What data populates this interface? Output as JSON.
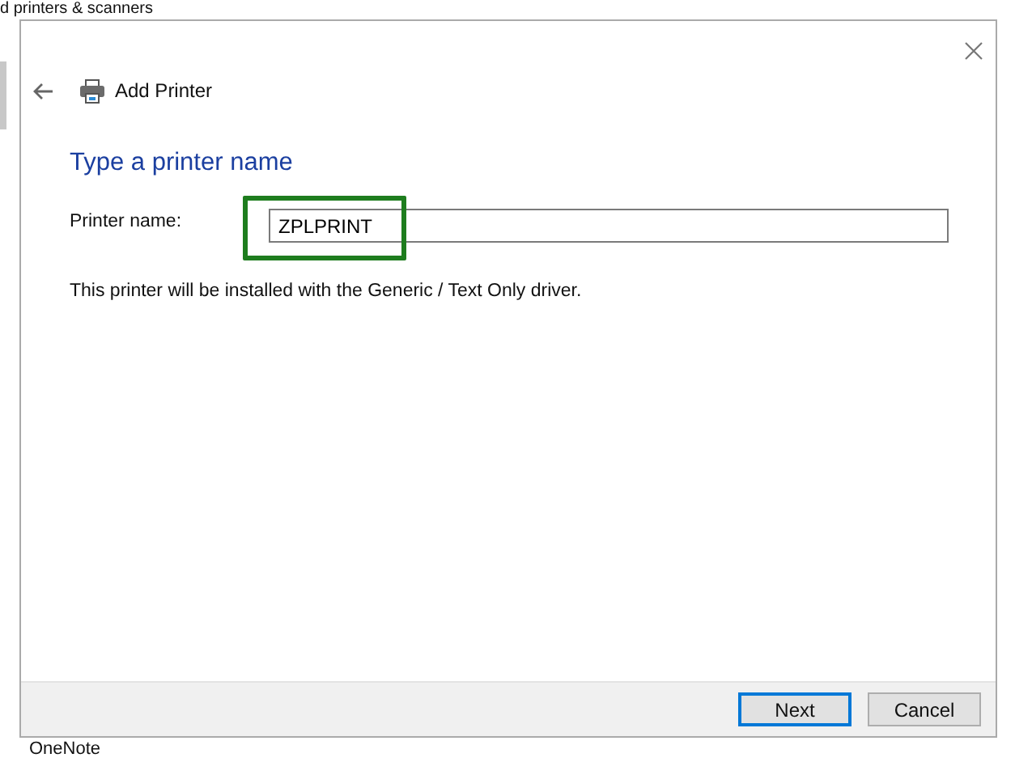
{
  "background": {
    "title": "d printers & scanners",
    "bottom_item": "OneNote"
  },
  "window": {
    "title": "Add Printer"
  },
  "heading": "Type a printer name",
  "printer_name": {
    "label": "Printer name:",
    "value": "ZPLPRINT",
    "highlighted": true
  },
  "note": "This printer will be installed with the Generic / Text Only driver.",
  "buttons": [
    {
      "label": "Next",
      "default": true
    },
    {
      "label": "Cancel",
      "default": false
    }
  ]
}
